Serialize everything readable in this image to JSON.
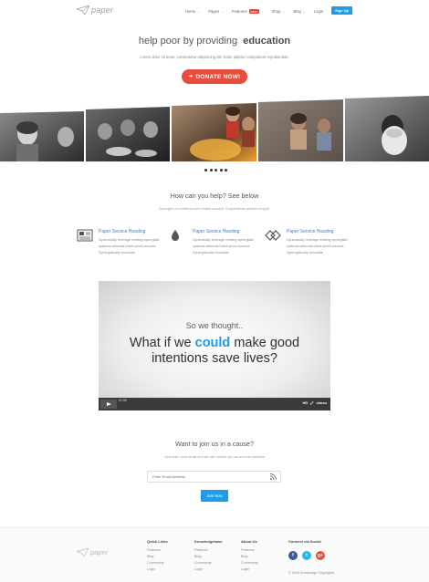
{
  "nav": {
    "logo": "paper",
    "items": [
      {
        "label": "Home",
        "chevron": true
      },
      {
        "label": "Pages",
        "chevron": true
      },
      {
        "label": "Features",
        "badge": "NEW",
        "chevron": true
      },
      {
        "label": "Shop",
        "chevron": true
      },
      {
        "label": "Blog",
        "chevron": true
      },
      {
        "label": "Login",
        "chevron": false
      }
    ],
    "signup_label": "Sign Up"
  },
  "hero": {
    "title_pre": "help poor by providing",
    "title_bold": "education",
    "subtitle": "Lorem dolor sit amet, consectetur adipisicing elit. Enim adipisci voluptatum repudiandae.",
    "donate_label": "DONATE NOW!"
  },
  "gallery": {
    "slide_count": 5
  },
  "help": {
    "title": "How can you help? See below",
    "subtitle": "Sed eget orci eleifend enim mattis suscipit. Suspendisse potenti congue.",
    "services": [
      {
        "icon": "newspaper-icon",
        "heading": "Paper Service Heading",
        "lines": [
          "Dynamically leverage existing synergistic",
          "systems whereas future-proof sources",
          "Synergistically formulate"
        ]
      },
      {
        "icon": "drop-icon",
        "heading": "Paper Service Heading",
        "lines": [
          "Dynamically leverage existing synergistic",
          "systems whereas future-proof sources",
          "Synergistically formulate"
        ]
      },
      {
        "icon": "diamond-link-icon",
        "heading": "Paper Service Heading",
        "lines": [
          "Dynamically leverage existing synergistic",
          "systems whereas future-proof sources",
          "Synergistically formulate"
        ]
      }
    ]
  },
  "video": {
    "small_text": "So we thought..",
    "big_line1_pre": "What if we",
    "big_line1_hl": "could",
    "big_line1_post": "make good",
    "big_line2": "intentions save lives?",
    "time": "01:08",
    "hd": "HD",
    "brand": "vimeo",
    "highlight_color": "#1e9be9"
  },
  "join": {
    "title": "Want to join us in a cause?",
    "subtitle": "Just enter your email and we will contact you as soon as possible",
    "email_placeholder": "Enter Email Address",
    "button_label": "Join Now"
  },
  "footer": {
    "logo": "paper",
    "columns": [
      {
        "heading": "Quick Links",
        "items": [
          "Features",
          "Blog",
          "Community",
          "Login"
        ]
      },
      {
        "heading": "Knowledgebase",
        "items": [
          "Features",
          "Blog",
          "Community",
          "Login"
        ]
      },
      {
        "heading": "About Us",
        "items": [
          "Features",
          "Blog",
          "Community",
          "Login"
        ]
      }
    ],
    "social_heading": "Connect via Social",
    "social": [
      {
        "icon": "facebook-icon",
        "glyph": "f",
        "color": "#3b5998"
      },
      {
        "icon": "twitter-icon",
        "glyph": "t",
        "color": "#29b6e8"
      },
      {
        "icon": "google-plus-icon",
        "glyph": "g+",
        "color": "#e74c3c"
      }
    ],
    "copyright": "© 2016 Knowledge Copyrights"
  },
  "colors": {
    "accent": "#1e9be9",
    "donate": "#e74c3c"
  }
}
